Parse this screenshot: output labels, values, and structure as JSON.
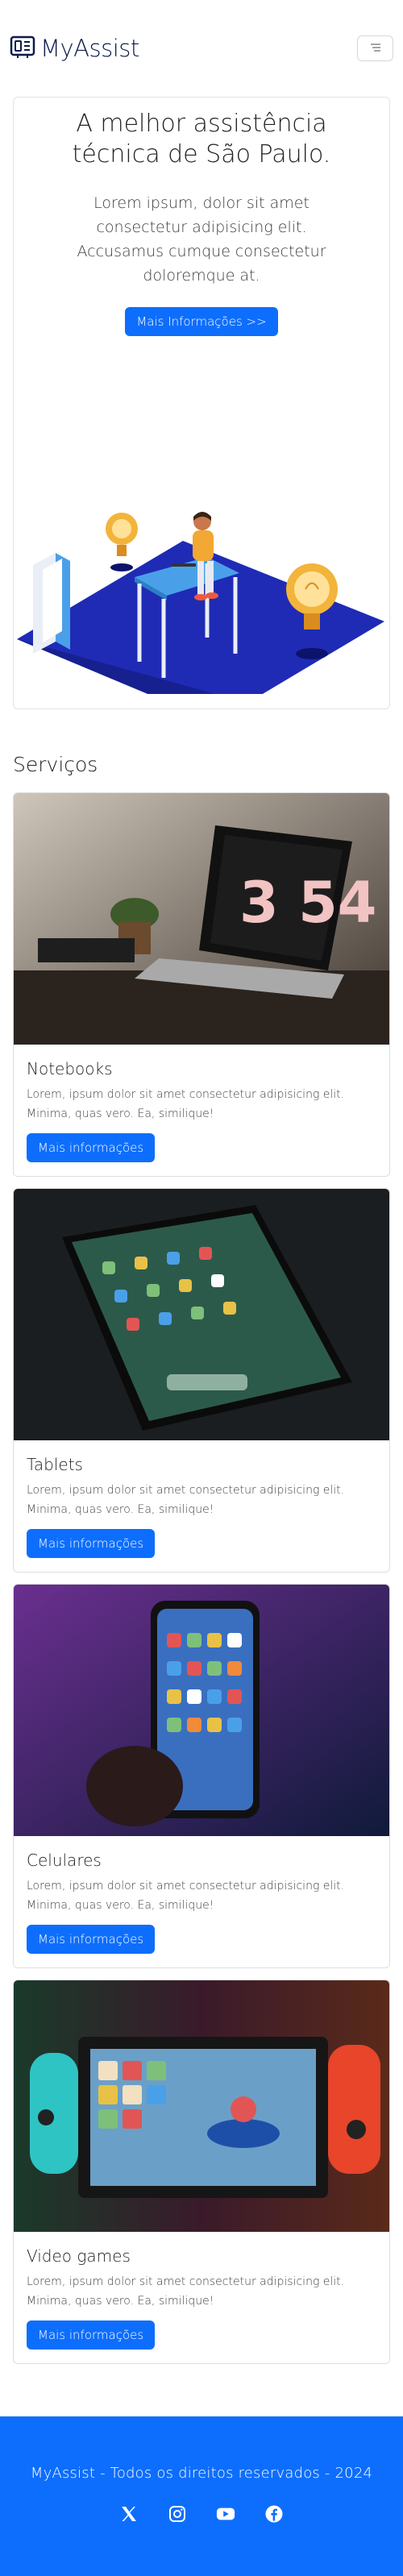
{
  "navbar": {
    "brand": "MyAssist"
  },
  "hero": {
    "title": "A melhor assistência técnica de São Paulo.",
    "text": "Lorem ipsum, dolor sit amet consectetur adipisicing elit. Accusamus cumque consectetur doloremque at.",
    "button": "Mais Informações >>"
  },
  "services": {
    "title": "Serviços",
    "cards": [
      {
        "title": "Notebooks",
        "text": "Lorem, ipsum dolor sit amet consectetur adipisicing elit. Minima, quas vero. Ea, similique!",
        "button": "Mais informações",
        "clock": "3 54"
      },
      {
        "title": "Tablets",
        "text": "Lorem, ipsum dolor sit amet consectetur adipisicing elit. Minima, quas vero. Ea, similique!",
        "button": "Mais informações"
      },
      {
        "title": "Celulares",
        "text": "Lorem, ipsum dolor sit amet consectetur adipisicing elit. Minima, quas vero. Ea, similique!",
        "button": "Mais informações"
      },
      {
        "title": "Video games",
        "text": "Lorem, ipsum dolor sit amet consectetur adipisicing elit. Minima, quas vero. Ea, similique!",
        "button": "Mais informações"
      }
    ]
  },
  "footer": {
    "text": "MyAssist - Todos os direitos reservados - 2024",
    "social": [
      "x-icon",
      "instagram-icon",
      "youtube-icon",
      "facebook-icon"
    ]
  },
  "colors": {
    "primary": "#0d6efd",
    "brand_text": "#0d1b4c",
    "illustration_floor": "#1f2bb5"
  }
}
